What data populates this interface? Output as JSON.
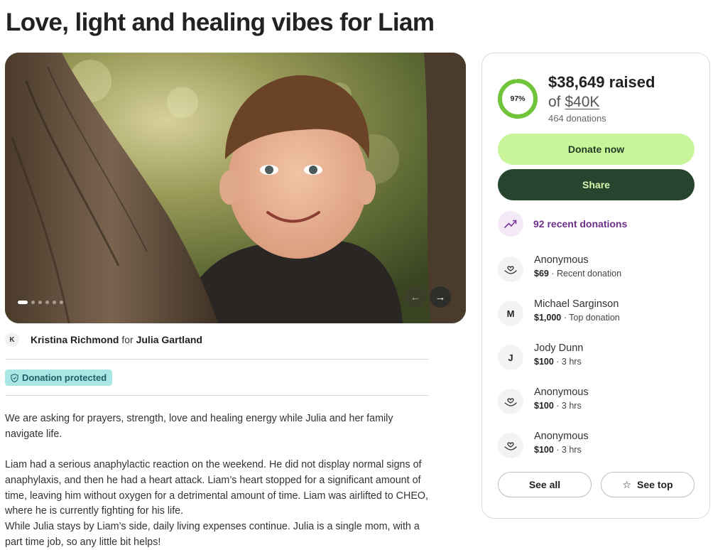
{
  "page": {
    "title": "Love, light and healing vibes for Liam"
  },
  "hero": {
    "slides_total": 6,
    "active_slide": 1,
    "prev_icon": "arrow-left-icon",
    "next_icon": "arrow-right-icon"
  },
  "organizer": {
    "avatar_initial": "K",
    "name": "Kristina Richmond",
    "connector": "for",
    "beneficiary": "Julia Gartland"
  },
  "badge": {
    "label": "Donation protected",
    "icon": "shield-icon"
  },
  "story": {
    "paragraph_1": "We are asking for prayers, strength, love and healing energy while Julia and her family navigate life.",
    "paragraph_2": "Liam had a serious anaphylactic reaction on the weekend. He did not display normal signs of anaphylaxis, and then he had a heart attack. Liam’s heart stopped for a significant amount of time, leaving him without oxygen for a detrimental amount of time. Liam was airlifted to CHEO, where he is currently fighting for his life.",
    "paragraph_3": "While Julia stays by Liam’s side, daily living expenses continue. Julia is a single mom, with a part time job, so any little bit helps!"
  },
  "progress": {
    "percent": 97,
    "percent_label": "97%",
    "raised": "$38,649 raised",
    "goal_prefix": "of",
    "goal_amount": "$40K",
    "donations_count": "464 donations"
  },
  "actions": {
    "donate_label": "Donate now",
    "share_label": "Share"
  },
  "recent": {
    "label": "92 recent donations",
    "icon": "trending-up-icon"
  },
  "donations": [
    {
      "name": "Anonymous",
      "avatar": "heart-hand-icon",
      "amount": "$69",
      "detail": "· Recent donation"
    },
    {
      "name": "Michael Sarginson",
      "avatar": "M",
      "amount": "$1,000",
      "detail": "· Top donation"
    },
    {
      "name": "Jody Dunn",
      "avatar": "J",
      "amount": "$100",
      "detail": "· 3 hrs"
    },
    {
      "name": "Anonymous",
      "avatar": "heart-hand-icon",
      "amount": "$100",
      "detail": "· 3 hrs"
    },
    {
      "name": "Anonymous",
      "avatar": "heart-hand-icon",
      "amount": "$100",
      "detail": "· 3 hrs"
    }
  ],
  "footer_buttons": {
    "see_all": "See all",
    "see_top": "See top",
    "see_top_icon": "star-icon"
  },
  "colors": {
    "donate_bg": "#c9f59a",
    "share_bg": "#26452f",
    "progress_green": "#6fc43a",
    "recent_purple": "#6c2f8a",
    "badge_bg": "#a9e7e4"
  }
}
